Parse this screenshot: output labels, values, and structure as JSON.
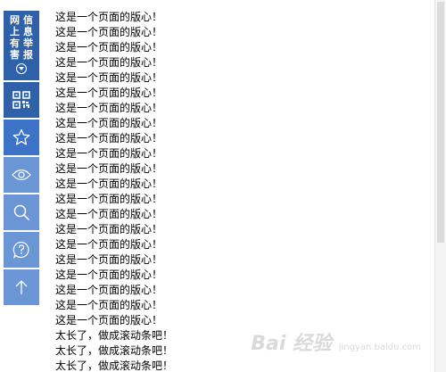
{
  "toolbar": {
    "report_label": [
      "网",
      "上",
      "有",
      "害",
      "信",
      "息",
      "举",
      "报"
    ],
    "colors": {
      "dark": "#2f61a8",
      "medium": "#3d73c6",
      "light": "#6b96d6"
    },
    "icons": [
      "qr-code-icon",
      "star-icon",
      "eye-icon",
      "search-icon",
      "help-icon",
      "arrow-up-icon"
    ]
  },
  "content": {
    "lines": [
      "这是一个页面的版心！",
      "这是一个页面的版心！",
      "这是一个页面的版心！",
      "这是一个页面的版心！",
      "这是一个页面的版心！",
      "这是一个页面的版心！",
      "这是一个页面的版心！",
      "这是一个页面的版心！",
      "这是一个页面的版心！",
      "这是一个页面的版心！",
      "这是一个页面的版心！",
      "这是一个页面的版心！",
      "这是一个页面的版心！",
      "这是一个页面的版心！",
      "这是一个页面的版心！",
      "这是一个页面的版心！",
      "这是一个页面的版心！",
      "这是一个页面的版心！",
      "这是一个页面的版心！",
      "这是一个页面的版心！",
      "这是一个页面的版心！",
      "太长了，做成滚动条吧！",
      "太长了，做成滚动条吧！",
      "太长了，做成滚动条吧！"
    ]
  },
  "watermark": {
    "text": "Bai 经验",
    "sub": "jingyan.baidu.com"
  }
}
